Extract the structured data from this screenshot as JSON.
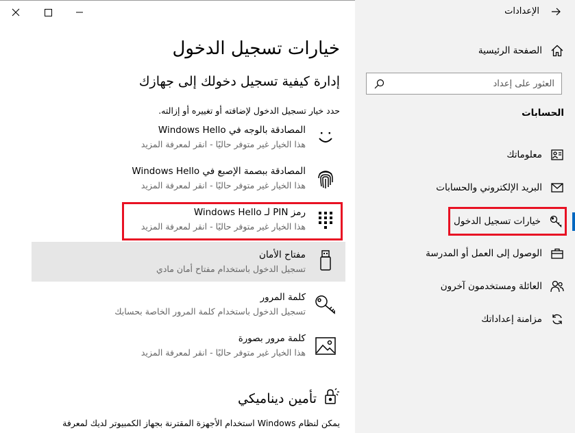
{
  "window": {
    "minimize_icon": "minimize-icon",
    "maximize_icon": "maximize-icon",
    "close_icon": "close-icon"
  },
  "nav": {
    "back_icon": "back-arrow-icon",
    "title": "الإعدادات",
    "home_label": "الصفحة الرئيسية",
    "search_placeholder": "العثور على إعداد",
    "section_label": "الحسابات",
    "items": [
      {
        "label": "معلوماتك",
        "icon": "person-icon"
      },
      {
        "label": "البريد الإلكتروني والحسابات",
        "icon": "mail-icon"
      },
      {
        "label": "خيارات تسجيل الدخول",
        "icon": "key-icon",
        "active": true
      },
      {
        "label": "الوصول إلى العمل أو المدرسة",
        "icon": "briefcase-icon"
      },
      {
        "label": "العائلة ومستخدمون آخرون",
        "icon": "people-icon"
      },
      {
        "label": "مزامنة إعداداتك",
        "icon": "sync-icon"
      }
    ]
  },
  "main": {
    "title": "خيارات تسجيل الدخول",
    "subtitle": "إدارة كيفية تسجيل دخولك إلى جهازك",
    "hint": "حدد خيار تسجيل الدخول لإضافته أو تغييره أو إزالته.",
    "options": [
      {
        "title": "المصادقة بالوجه في Windows Hello",
        "desc": "هذا الخيار غير متوفر حاليًا - انقر لمعرفة المزيد",
        "icon": "face-icon"
      },
      {
        "title": "المصادقة ببصمة الإصبع في Windows Hello",
        "desc": "هذا الخيار غير متوفر حاليًا - انقر لمعرفة المزيد",
        "icon": "fingerprint-icon"
      },
      {
        "title": "رمز PIN لـ Windows Hello",
        "desc": "هذا الخيار غير متوفر حاليًا - انقر لمعرفة المزيد",
        "icon": "pin-keypad-icon"
      },
      {
        "title": "مفتاح الأمان",
        "desc": "تسجيل الدخول باستخدام مفتاح أمان مادي",
        "icon": "usb-key-icon"
      },
      {
        "title": "كلمة المرور",
        "desc": "تسجيل الدخول باستخدام كلمة المرور الخاصة بحسابك",
        "icon": "key-icon"
      },
      {
        "title": "كلمة مرور بصورة",
        "desc": "هذا الخيار غير متوفر حاليًا - انقر لمعرفة المزيد",
        "icon": "picture-icon"
      }
    ],
    "dynamic_lock": {
      "title": "تأمين ديناميكي",
      "icon": "dynamic-lock-icon",
      "desc": "يمكن لنظام Windows استخدام الأجهزة المقترنة بجهاز الكمبيوتر لديك لمعرفة"
    }
  },
  "colors": {
    "highlight_border": "#e81123",
    "accent": "#0067c0",
    "nav_background": "#f2f2f2",
    "hover_background": "#e6e6e6",
    "secondary_text": "#666666"
  }
}
